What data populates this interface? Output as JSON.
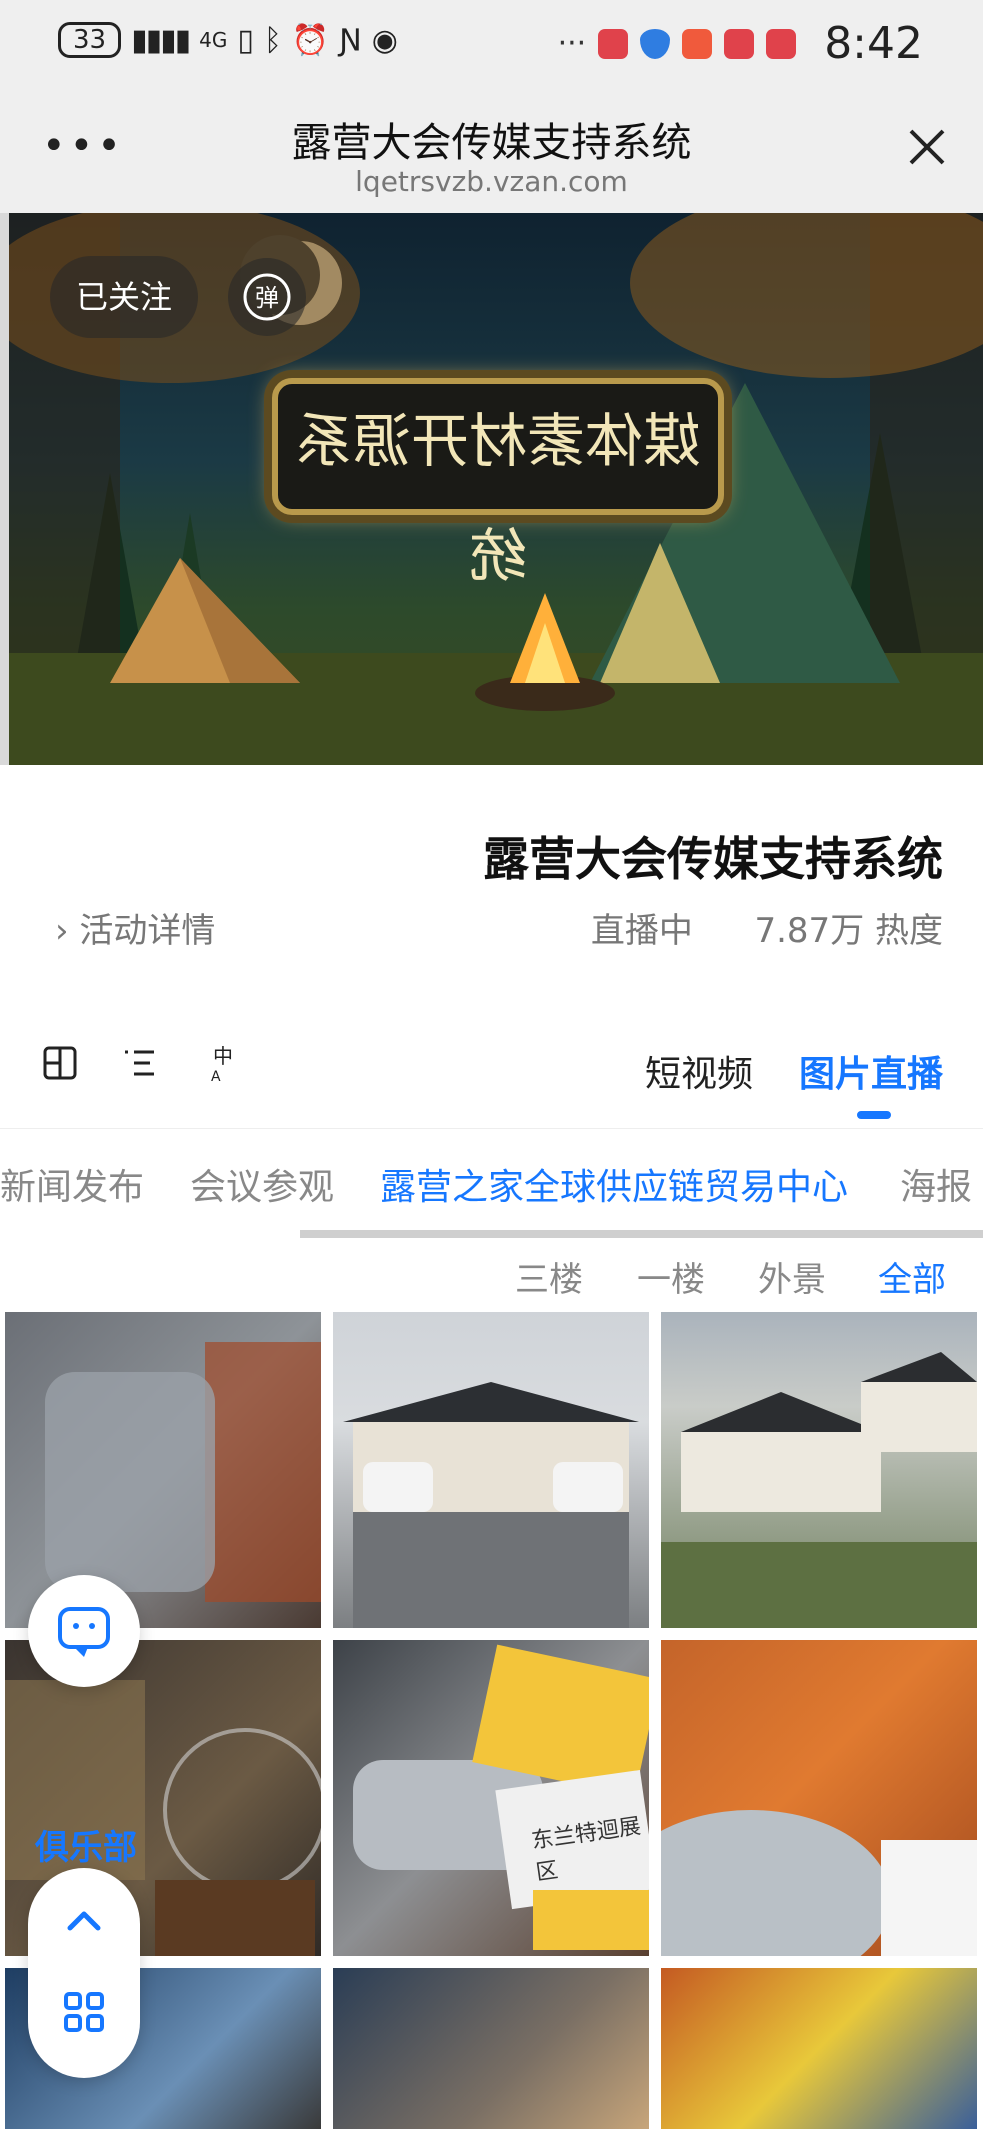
{
  "status_bar": {
    "time": "8:42",
    "battery": "33",
    "network": "4G",
    "colors": {
      "accent_red": "#e0424b",
      "accent_blue": "#2f7de1"
    }
  },
  "title_bar": {
    "title": "露营大会传媒支持系统",
    "url": "lqetrsvzb.vzan.com",
    "more_icon": "more-dots-icon",
    "close_icon": "close-icon"
  },
  "banner": {
    "follow_label": "已关注",
    "danmu_label": "弹",
    "plaque_text": "媒体素材开源系统"
  },
  "event": {
    "title": "露营大会传媒支持系统",
    "status": "直播中",
    "heat": "7.87万 热度",
    "detail_link": "活动详情"
  },
  "tabs": {
    "active": "图片直播",
    "second": "短视频",
    "tools": [
      "layout-grid-icon",
      "list-icon",
      "translate-icon"
    ],
    "accent": "#1677ff"
  },
  "categories": {
    "items": [
      "海报",
      "露营之家全球供应链贸易中心",
      "会议参观",
      "新闻发布"
    ],
    "active_index": 1
  },
  "subcategories": {
    "items": [
      "全部",
      "外景",
      "一楼",
      "三楼"
    ],
    "active_index": 0
  },
  "photos": {
    "labels": [
      "东兰特迴展区",
      "俱乐部"
    ]
  },
  "floating": {
    "chat_icon": "chat-bubble-icon",
    "up_icon": "chevron-up-icon",
    "apps_icon": "apps-grid-icon"
  }
}
